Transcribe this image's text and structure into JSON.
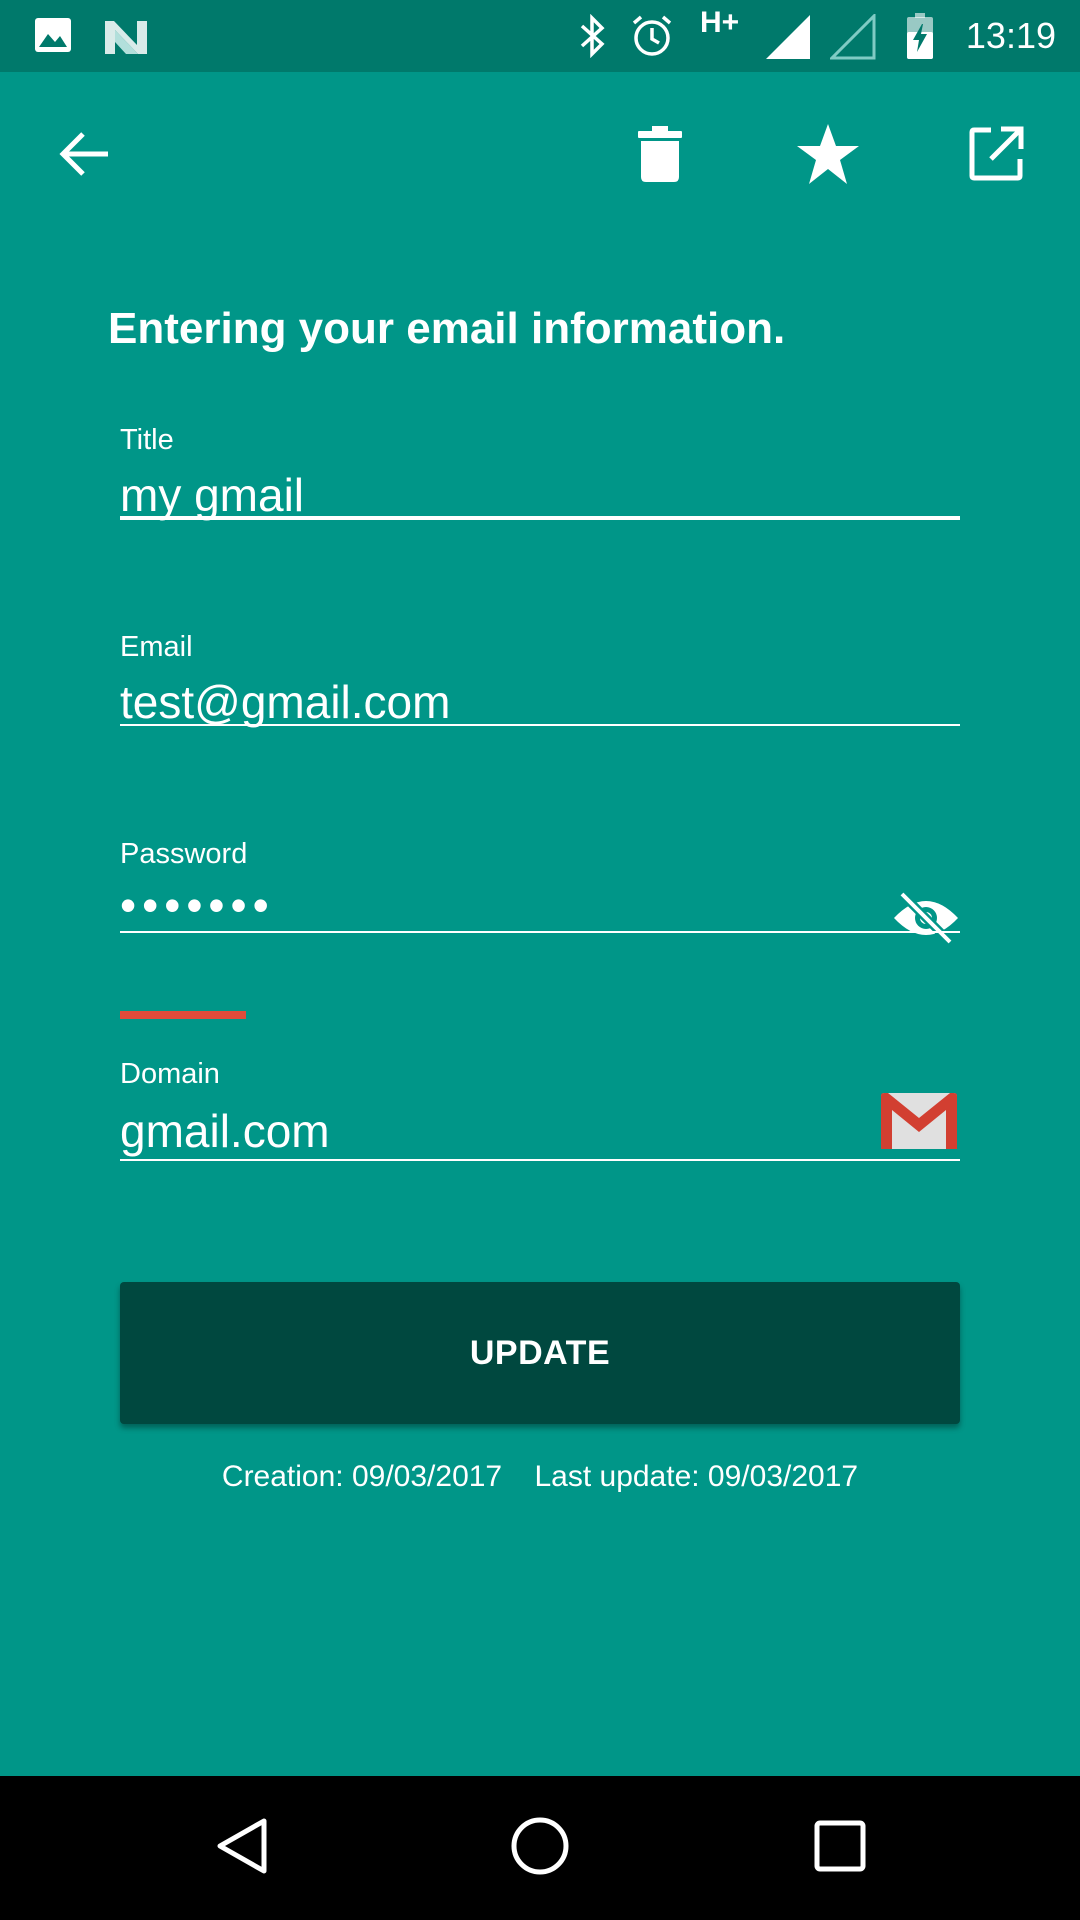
{
  "status_bar": {
    "time": "13:19",
    "network_type": "H+",
    "icons": [
      "image-notification-icon",
      "n-notification-icon",
      "bluetooth-icon",
      "alarm-icon",
      "signal-icon",
      "signal-empty-icon",
      "battery-charging-icon"
    ]
  },
  "toolbar": {
    "icons": [
      "back-arrow-icon",
      "delete-icon",
      "star-icon",
      "open-external-icon"
    ]
  },
  "form": {
    "heading": "Entering your email information.",
    "title": {
      "label": "Title",
      "value": "my gmail"
    },
    "email": {
      "label": "Email",
      "value": "test@gmail.com"
    },
    "password": {
      "label": "Password",
      "value": "•••••••",
      "toggle_icon": "visibility-off-icon"
    },
    "domain": {
      "label": "Domain",
      "value": "gmail.com",
      "icon": "gmail-icon"
    },
    "update_label": "UPDATE",
    "creation": "Creation: 09/03/2017",
    "last_update": "Last update: 09/03/2017"
  },
  "colors": {
    "background": "#009688",
    "status_bar": "#00796B",
    "button": "#00483F",
    "strength_indicator": "#E04B3A",
    "nav_bar": "#000000"
  },
  "nav_bar": {
    "icons": [
      "back-triangle-icon",
      "home-circle-icon",
      "recents-square-icon"
    ]
  }
}
